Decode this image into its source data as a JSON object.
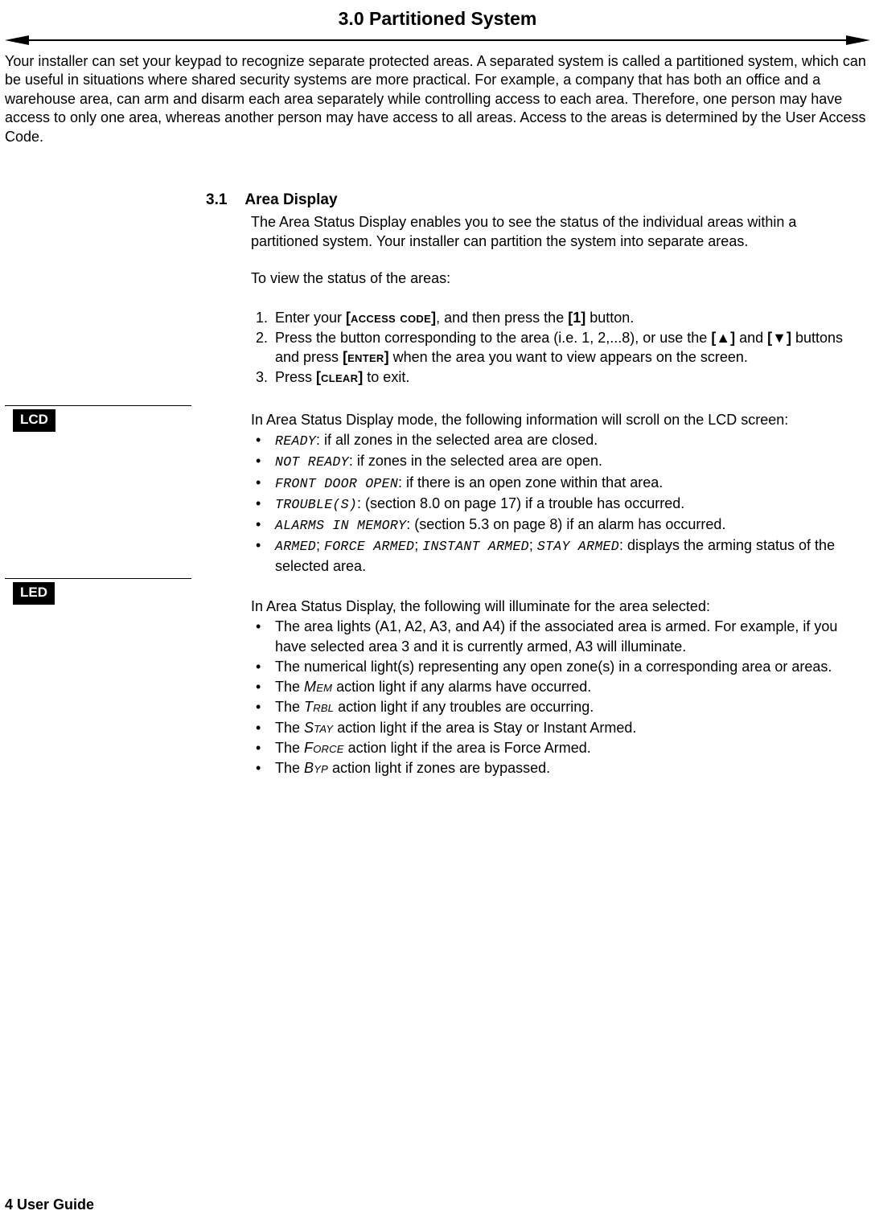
{
  "header": "3.0 Partitioned System",
  "intro": "Your installer can set your keypad to recognize separate protected areas. A separated system is called a partitioned system, which can be useful in situations where shared security systems are more practical. For example, a company that has both an office and a warehouse area, can arm and disarm each area separately while controlling access to each area. Therefore, one person may have access to only one area, whereas another person may have access to all areas. Access to the areas is determined by the User Access Code.",
  "section": {
    "num": "3.1",
    "title": "Area Display",
    "p1": "The Area Status Display enables you to see the status of the individual areas within a partitioned system. Your installer can partition the system into separate areas.",
    "p2": "To view the status of the areas:",
    "steps": {
      "s1a": "Enter your ",
      "s1_key": "[ACCESS CODE]",
      "s1b": ", and then press the ",
      "s1_key2": "[1]",
      "s1c": " button.",
      "s2a": "Press the button corresponding to the area (i.e. 1, 2,...8), or use the ",
      "s2_up": "[▲]",
      "s2_mid": " and ",
      "s2_dn": "[▼]",
      "s2b": " buttons and press ",
      "s2_key": "[ENTER]",
      "s2c": " when the area you want to view appears on the screen.",
      "s3a": "Press ",
      "s3_key": "[CLEAR]",
      "s3b": " to exit."
    }
  },
  "lcd": {
    "label": "LCD",
    "lead": "In Area Status Display mode, the following information will scroll on the LCD screen:",
    "items": [
      {
        "code": "READY",
        "rest": ": if all zones in the selected area are closed."
      },
      {
        "code": "NOT READY",
        "rest": ": if zones in the selected area are open."
      },
      {
        "code": "FRONT DOOR OPEN",
        "rest": ": if there is an open zone within that area."
      },
      {
        "code": "TROUBLE(S)",
        "rest": ": (section 8.0 on page 17) if a trouble has occurred."
      },
      {
        "code": "ALARMS IN MEMORY",
        "rest": ": (section 5.3 on page 8) if an alarm has occurred."
      },
      {
        "code": "ARMED",
        "sep1": "; ",
        "code2": "FORCE ARMED",
        "sep2": "; ",
        "code3": "INSTANT ARMED",
        "sep3": "; ",
        "code4": "STAY ARMED",
        "rest": ": displays the arming status of the selected area."
      }
    ]
  },
  "led": {
    "label": "LED",
    "lead": "In Area Status Display, the following will illuminate for the area selected:",
    "items": [
      "The area lights (A1, A2, A3, and A4) if the associated area is armed. For example, if you have selected area 3 and it is currently armed, A3 will illuminate.",
      "The numerical light(s) representing any open zone(s) in a corresponding area or areas."
    ],
    "sc_items": [
      {
        "pre": "The ",
        "sc": "Mem",
        "post": " action light if any alarms have occurred."
      },
      {
        "pre": "The ",
        "sc": "Trbl",
        "post": " action light if any troubles are occurring."
      },
      {
        "pre": "The ",
        "sc": "Stay",
        "post": " action light if the area is Stay or Instant Armed."
      },
      {
        "pre": "The ",
        "sc": "Force",
        "post": " action light if the area is Force Armed."
      },
      {
        "pre": "The ",
        "sc": "Byp",
        "post": " action light if zones are bypassed."
      }
    ]
  },
  "footer": "4 User Guide"
}
